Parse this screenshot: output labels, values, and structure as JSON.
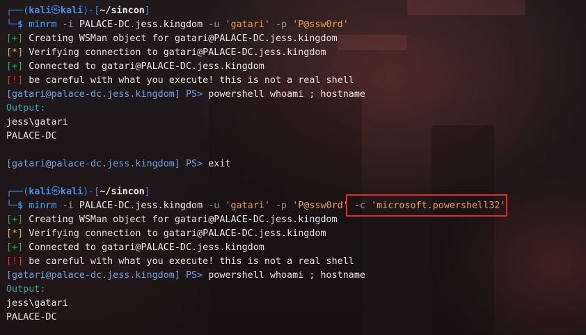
{
  "terminal": {
    "blocks": [
      {
        "prompt": {
          "corner_top": "┌──(",
          "user": "kali",
          "skull": "㉿",
          "host": "kali",
          "mid": ")-[",
          "path": "~/sincon",
          "close": "]",
          "corner_bottom": "└─",
          "dollar": "$"
        },
        "command": {
          "bin": "minrm",
          "opt_i": "-i",
          "target": "PALACE-DC.jess.kingdom",
          "opt_u": "-u",
          "user": "'gatari'",
          "opt_p": "-p",
          "pass": "'P@ssw0rd'"
        },
        "lines": {
          "creating_tag": "[+]",
          "creating_text": "Creating WSMan object for gatari@PALACE-DC.jess.kingdom",
          "verifying_tag": "[*]",
          "verifying_text": "Verifying connection to gatari@PALACE-DC.jess.kingdom",
          "connected_tag": "[+]",
          "connected_text": "Connected to gatari@PALACE-DC.jess.kingdom",
          "warning_tag": "[!]",
          "warning_text": "be careful with what you execute! this is not a real shell",
          "ps_prompt_host": "[gatari@palace-dc.jess.kingdom]",
          "ps_prompt_ps": "PS>",
          "ps_command": "powershell whoami ; hostname",
          "output_label": "Output:",
          "output_1": "jess\\gatari",
          "output_2": "PALACE-DC",
          "ps_prompt_host_2": "[gatari@palace-dc.jess.kingdom]",
          "ps_prompt_ps_2": "PS>",
          "ps_command_2": "exit"
        }
      },
      {
        "prompt": {
          "corner_top": "┌──(",
          "user": "kali",
          "skull": "㉿",
          "host": "kali",
          "mid": ")-[",
          "path": "~/sincon",
          "close": "]",
          "corner_bottom": "└─",
          "dollar": "$"
        },
        "command": {
          "bin": "minrm",
          "opt_i": "-i",
          "target": "PALACE-DC.jess.kingdom",
          "opt_u": "-u",
          "user": "'gatari'",
          "opt_p": "-p",
          "pass": "'P@ssw0rd'",
          "opt_c": "-c",
          "config": "'microsoft.powershell32'"
        },
        "lines": {
          "creating_tag": "[+]",
          "creating_text": "Creating WSMan object for gatari@PALACE-DC.jess.kingdom",
          "verifying_tag": "[*]",
          "verifying_text": "Verifying connection to gatari@PALACE-DC.jess.kingdom",
          "connected_tag": "[+]",
          "connected_text": "Connected to gatari@PALACE-DC.jess.kingdom",
          "warning_tag": "[!]",
          "warning_text": "be careful with what you execute! this is not a real shell",
          "ps_prompt_host": "[gatari@palace-dc.jess.kingdom]",
          "ps_prompt_ps": "PS>",
          "ps_command": "powershell whoami ; hostname",
          "output_label": "Output:",
          "output_1": "jess\\gatari",
          "output_2": "PALACE-DC"
        }
      }
    ],
    "colors": {
      "highlight_box": "#e22a2a",
      "prompt_blue": "#3f8fe6",
      "tag_green": "#27b34a",
      "tag_yellow": "#e3b529",
      "tag_red": "#e0303a",
      "string_orange": "#e7a14a"
    }
  }
}
